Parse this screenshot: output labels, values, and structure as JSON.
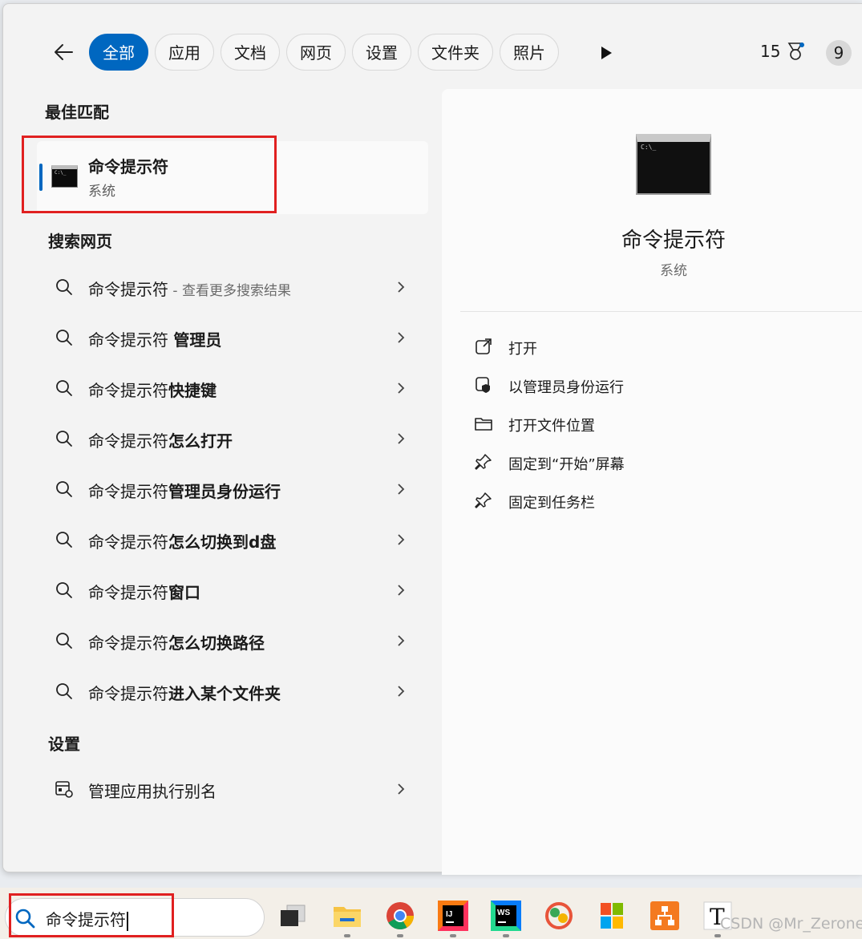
{
  "filters": {
    "tabs": [
      {
        "label": "全部",
        "active": true
      },
      {
        "label": "应用"
      },
      {
        "label": "文档"
      },
      {
        "label": "网页"
      },
      {
        "label": "设置"
      },
      {
        "label": "文件夹"
      },
      {
        "label": "照片"
      }
    ],
    "points": "15",
    "avatar_letter": "9"
  },
  "best_match": {
    "heading": "最佳匹配",
    "title": "命令提示符",
    "subtitle": "系统",
    "icon": "cmd-icon"
  },
  "web": {
    "heading": "搜索网页",
    "items": [
      {
        "prefix": "命令提示符",
        "bold": "",
        "suffix": " - 查看更多搜索结果"
      },
      {
        "prefix": "命令提示符 ",
        "bold": "管理员",
        "suffix": ""
      },
      {
        "prefix": "命令提示符",
        "bold": "快捷键",
        "suffix": ""
      },
      {
        "prefix": "命令提示符",
        "bold": "怎么打开",
        "suffix": ""
      },
      {
        "prefix": "命令提示符",
        "bold": "管理员身份运行",
        "suffix": ""
      },
      {
        "prefix": "命令提示符",
        "bold": "怎么切换到d盘",
        "suffix": ""
      },
      {
        "prefix": "命令提示符",
        "bold": "窗口",
        "suffix": ""
      },
      {
        "prefix": "命令提示符",
        "bold": "怎么切换路径",
        "suffix": ""
      },
      {
        "prefix": "命令提示符",
        "bold": "进入某个文件夹",
        "suffix": ""
      }
    ]
  },
  "settings": {
    "heading": "设置",
    "item": "管理应用执行别名"
  },
  "detail": {
    "title": "命令提示符",
    "subtitle": "系统",
    "actions": [
      {
        "label": "打开",
        "icon": "open-external-icon"
      },
      {
        "label": "以管理员身份运行",
        "icon": "shield-icon"
      },
      {
        "label": "打开文件位置",
        "icon": "folder-icon"
      },
      {
        "label": "固定到“开始”屏幕",
        "icon": "pin-icon"
      },
      {
        "label": "固定到任务栏",
        "icon": "pin-icon"
      }
    ]
  },
  "taskbar": {
    "search_value": "命令提示符",
    "apps": [
      "task-view",
      "file-explorer",
      "chrome",
      "intellij-idea",
      "webstorm",
      "navicat",
      "windows-store",
      "xmind",
      "typora"
    ]
  },
  "watermark": "CSDN @Mr_Zerone",
  "colors": {
    "accent": "#0067c0",
    "highlight": "#e02020"
  }
}
